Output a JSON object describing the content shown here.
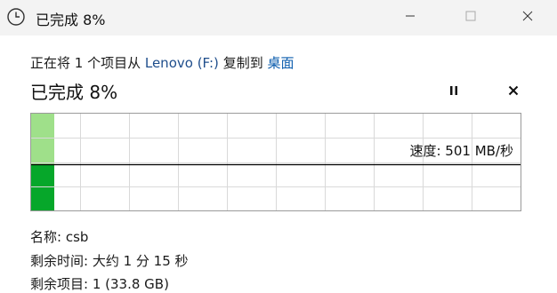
{
  "window": {
    "title": "已完成 8%",
    "icon": "clock-icon",
    "controls": [
      "minimize-icon",
      "maximize-icon",
      "close-icon"
    ]
  },
  "copy": {
    "prefix": "正在将 1 个项目从 ",
    "source": "Lenovo (F:)",
    "middle": " 复制到 ",
    "destination": "桌面"
  },
  "status": {
    "text": "已完成 8%",
    "percent": 8
  },
  "graph": {
    "speed_label": "速度: 501 MB/秒",
    "progress_fraction": 0.08,
    "colors": {
      "history_fill": "#9fe08a",
      "current_fill": "#06a72a",
      "grid": "#d9d9d9",
      "speed_line": "#000000"
    }
  },
  "details": {
    "name": "名称: csb",
    "time_remaining": "剩余时间: 大约 1 分 15 秒",
    "items_remaining": "剩余项目: 1 (33.8 GB)"
  }
}
